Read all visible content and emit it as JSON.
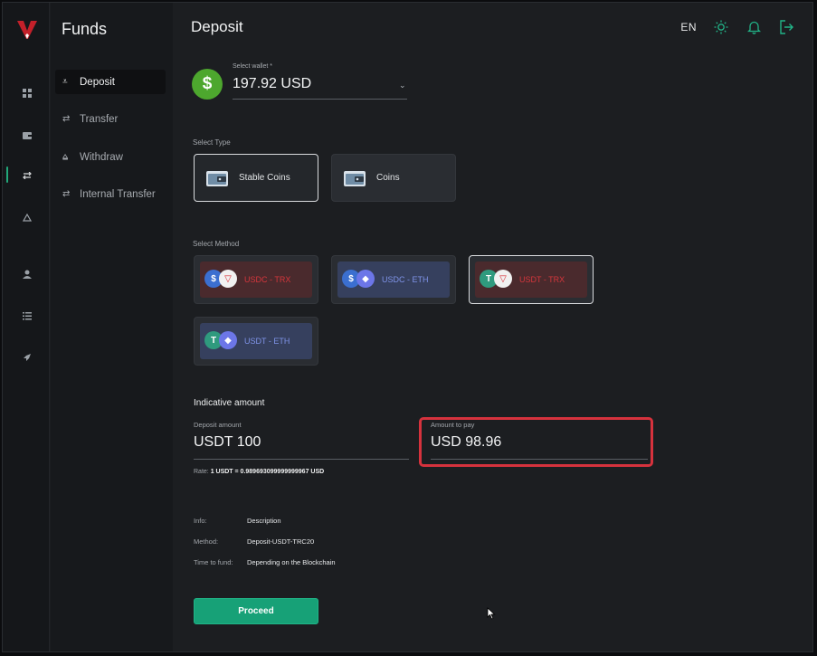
{
  "sidebar": {
    "title": "Funds",
    "items": [
      {
        "label": "Deposit",
        "icon": "deposit-icon"
      },
      {
        "label": "Transfer",
        "icon": "transfer-icon"
      },
      {
        "label": "Withdraw",
        "icon": "withdraw-icon"
      },
      {
        "label": "Internal Transfer",
        "icon": "transfer-icon"
      }
    ],
    "active_item": "Deposit"
  },
  "rail": {
    "icons": [
      "dashboard-icon",
      "wallet-icon",
      "funds-icon",
      "recycle-icon",
      "user-icon",
      "list-icon",
      "rocket-icon"
    ],
    "active_icon": "funds-icon",
    "accent_color": "#22a87a"
  },
  "header": {
    "title": "Deposit",
    "language": "EN",
    "icons": [
      "sun-icon",
      "bell-icon",
      "logout-icon"
    ]
  },
  "wallet": {
    "label": "Select wallet *",
    "value": "197.92 USD",
    "currency_symbol": "$"
  },
  "type_section": {
    "label": "Select Type",
    "options": [
      {
        "label": "Stable Coins",
        "selected": true
      },
      {
        "label": "Coins",
        "selected": false
      }
    ]
  },
  "method_section": {
    "label": "Select Method",
    "options": [
      {
        "label": "USDC - TRX",
        "selected": false
      },
      {
        "label": "USDC - ETH",
        "selected": false
      },
      {
        "label": "USDT - TRX",
        "selected": true
      },
      {
        "label": "USDT - ETH",
        "selected": false
      }
    ]
  },
  "amount": {
    "title": "Indicative amount",
    "deposit_label": "Deposit amount",
    "deposit_value": "USDT 100",
    "pay_label": "Amount to pay",
    "pay_value": "USD 98.96",
    "rate_label": "Rate:",
    "rate_value": "1 USDT = 0.989693099999999967 USD",
    "highlight_color": "#d6323d"
  },
  "info": {
    "rows": [
      {
        "key": "Info:",
        "value": "Description"
      },
      {
        "key": "Method:",
        "value": "Deposit-USDT-TRC20"
      },
      {
        "key": "Time to fund:",
        "value": "Depending on the Blockchain"
      }
    ]
  },
  "actions": {
    "proceed_label": "Proceed",
    "proceed_color": "#17a177"
  }
}
